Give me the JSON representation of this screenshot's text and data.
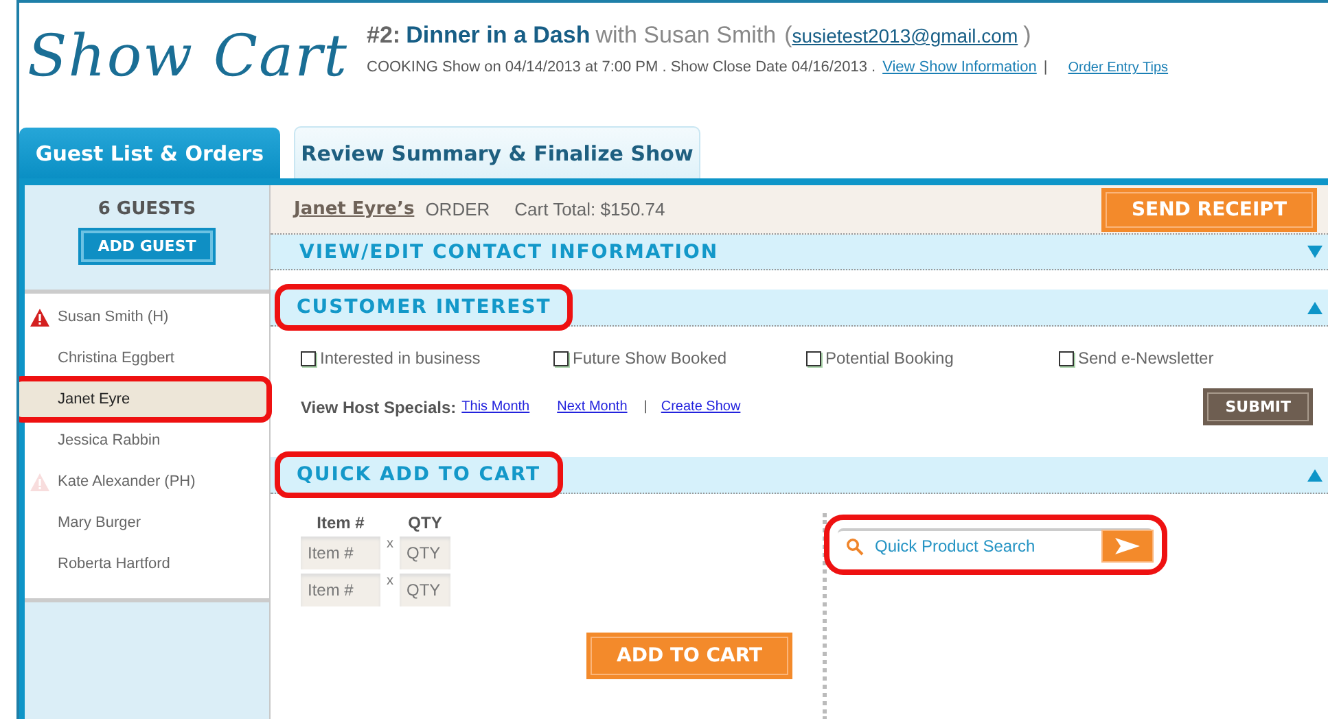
{
  "logo": "Show Cart",
  "show": {
    "number": "#2:",
    "name": "Dinner in a Dash",
    "with": "with Susan Smith",
    "open_paren": "(",
    "email": "susietest2013@gmail.com",
    "close_paren": ")",
    "details": "COOKING Show on 04/14/2013 at 7:00 PM . Show Close Date 04/16/2013 .",
    "info_link": "View Show Information",
    "separator": "|",
    "tips_link": "Order Entry Tips"
  },
  "tabs": [
    {
      "label": "Guest List & Orders",
      "selected": true
    },
    {
      "label": "Review Summary & Finalize Show",
      "selected": false
    }
  ],
  "sidebar": {
    "count": "6 GUESTS",
    "add_button": "ADD GUEST",
    "guests": [
      {
        "name": "Susan Smith  (H)",
        "kind": "alert",
        "selected": false,
        "highlighted": false
      },
      {
        "name": "Christina Eggbert",
        "kind": "plain",
        "selected": false,
        "highlighted": false
      },
      {
        "name": "Janet Eyre",
        "kind": "plain",
        "selected": true,
        "highlighted": true
      },
      {
        "name": "Jessica Rabbin",
        "kind": "plain",
        "selected": false,
        "highlighted": false
      },
      {
        "name": "Kate Alexander  (PH)",
        "kind": "faded_alert",
        "selected": false,
        "highlighted": false
      },
      {
        "name": "Mary Burger",
        "kind": "plain",
        "selected": false,
        "highlighted": false
      },
      {
        "name": "Roberta Hartford",
        "kind": "plain",
        "selected": false,
        "highlighted": false
      }
    ]
  },
  "order": {
    "owner": "Janet Eyre’s",
    "label": "ORDER",
    "total": "Cart Total: $150.74",
    "send_button": "SEND RECEIPT"
  },
  "sections": [
    {
      "title": "VIEW/EDIT CONTACT INFORMATION",
      "expanded": false,
      "highlighted": false
    },
    {
      "title": "CUSTOMER INTEREST",
      "expanded": true,
      "highlighted": true
    },
    {
      "title": "QUICK ADD TO CART",
      "expanded": true,
      "highlighted": true
    }
  ],
  "interests": [
    {
      "label": "Interested in business",
      "checked": false
    },
    {
      "label": "Future Show Booked",
      "checked": false
    },
    {
      "label": "Potential Booking",
      "checked": false
    },
    {
      "label": "Send e-Newsletter",
      "checked": false
    }
  ],
  "host_specials": {
    "label": "View Host Specials:",
    "links": [
      "This Month",
      "Next Month"
    ],
    "separator": "|",
    "create_link": "Create Show",
    "submit": "SUBMIT"
  },
  "quick_add": {
    "columns": [
      "Item #",
      "QTY"
    ],
    "rows": [
      {
        "item_placeholder": "Item #",
        "times": "x",
        "qty_placeholder": "QTY"
      },
      {
        "item_placeholder": "Item #",
        "times": "x",
        "qty_placeholder": "QTY"
      }
    ],
    "add_button": "ADD TO CART",
    "search": {
      "placeholder": "Quick Product Search",
      "highlighted": true
    }
  }
}
